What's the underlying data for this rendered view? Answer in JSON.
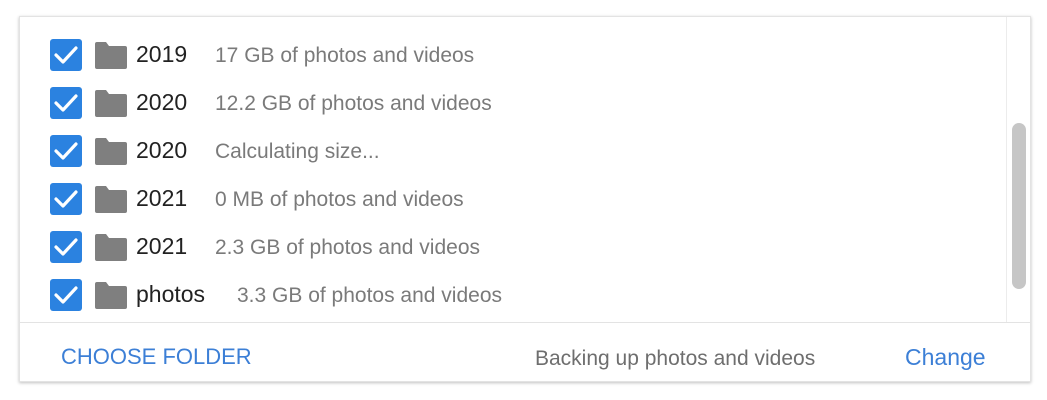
{
  "folders": [
    {
      "name": "2019",
      "size": "17 GB of photos and videos",
      "checked": true
    },
    {
      "name": "2020",
      "size": "12.2 GB of photos and videos",
      "checked": true
    },
    {
      "name": "2020",
      "size": "Calculating size...",
      "checked": true
    },
    {
      "name": "2021",
      "size": "0 MB of photos and videos",
      "checked": true
    },
    {
      "name": "2021",
      "size": "2.3 GB of photos and videos",
      "checked": true
    },
    {
      "name": "photos",
      "size": "3.3 GB of photos and videos",
      "checked": true
    }
  ],
  "footer": {
    "choose_folder_label": "CHOOSE FOLDER",
    "status_text": "Backing up photos and videos",
    "change_label": "Change"
  },
  "icons": {
    "checkbox": "checkbox-checked-icon",
    "folder": "folder-icon"
  },
  "colors": {
    "accent": "#2b82e0",
    "link": "#3c7fd6",
    "folder_icon": "#7f7f7f"
  }
}
